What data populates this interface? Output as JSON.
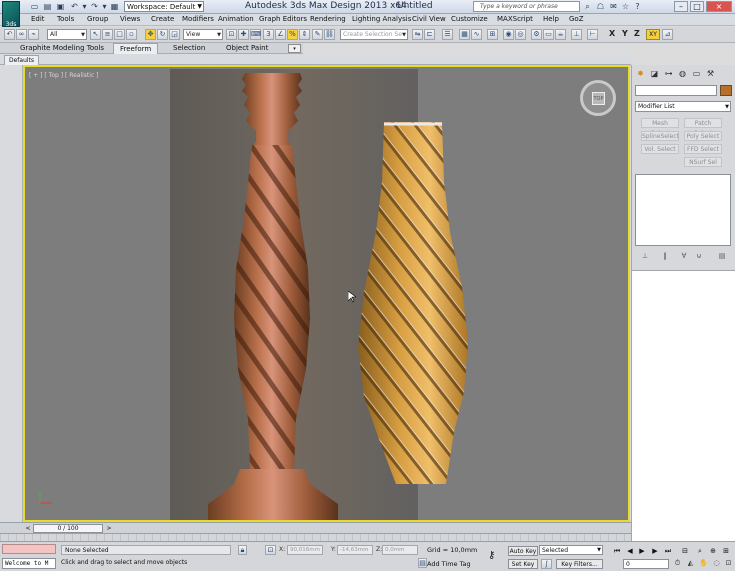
{
  "titlebar": {
    "logo_text": "3ds",
    "workspace": "Workspace: Default",
    "app_title": "Autodesk 3ds Max Design 2013 x64",
    "doc_title": "Untitled",
    "search_placeholder": "Type a keyword or phrase",
    "min": "–",
    "max": "□",
    "close": "×"
  },
  "menu": [
    "Edit",
    "Tools",
    "Group",
    "Views",
    "Create",
    "Modifiers",
    "Animation",
    "Graph Editors",
    "Rendering",
    "Lighting Analysis",
    "Civil View",
    "Customize",
    "MAXScript",
    "Help",
    "GoZ"
  ],
  "toolbar": {
    "selection_filter": "All",
    "ref_coord": "View",
    "named_selection_placeholder": "Create Selection Se",
    "axis_x": "X",
    "axis_y": "Y",
    "axis_z": "Z",
    "axis_xy": "XY"
  },
  "ribbon": {
    "tabs": [
      "Graphite Modeling Tools",
      "Freeform",
      "Selection",
      "Object Paint"
    ],
    "active_tab": "Freeform",
    "panel_tab": "Defaults"
  },
  "viewport": {
    "label": "[ + ] [ Top ] [ Realistic ]",
    "viewcube_text": "TOP"
  },
  "command_panel": {
    "modifier_list": "Modifier List",
    "buttons": [
      "Mesh Select",
      "Patch Select",
      "SplineSelect",
      "Poly Select",
      "Vol. Select",
      "FFD Select",
      "NSurf Sel"
    ],
    "object_color": "#b5712b"
  },
  "time_slider": {
    "frame_display": "0 / 100",
    "prev": "<",
    "next": ">"
  },
  "status": {
    "listener_text": "Welcome to M",
    "selection": "None Selected",
    "prompt": "Click and drag to select and move objects",
    "x_label": "X:",
    "x_value": "90,016mm",
    "y_label": "Y:",
    "y_value": "-14,63mm",
    "z_label": "Z:",
    "z_value": "0,0mm",
    "grid": "Grid = 10,0mm",
    "add_time_tag": "Add Time Tag",
    "auto_key": "Auto Key",
    "set_key": "Set Key",
    "selected_dd": "Selected",
    "key_filters": "Key Filters...",
    "frame": "0"
  }
}
